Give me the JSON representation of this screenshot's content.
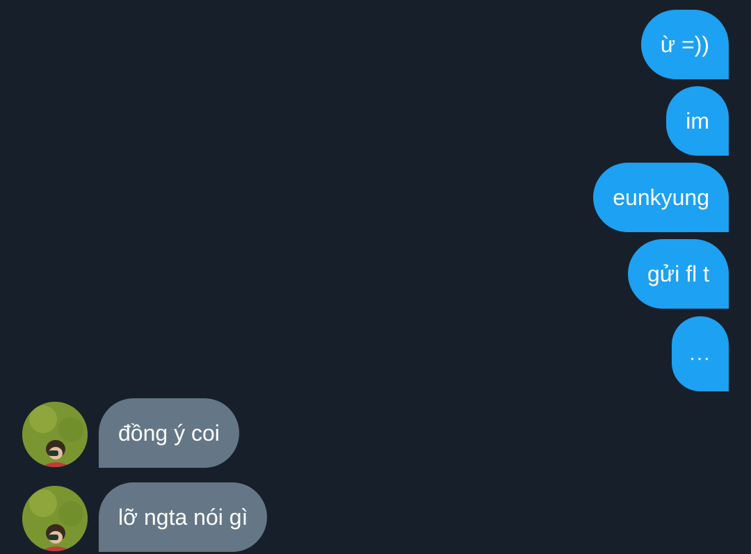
{
  "conversation": {
    "outgoing": [
      {
        "text": "ừ =))"
      },
      {
        "text": "im"
      },
      {
        "text": "eunkyung"
      },
      {
        "text": "gửi fl t"
      },
      {
        "text": "..."
      }
    ],
    "incoming": [
      {
        "text": "đồng ý coi"
      },
      {
        "text": "lỡ ngta nói gì"
      }
    ]
  },
  "colors": {
    "background": "#17202a",
    "outgoing_bubble": "#1da1f2",
    "incoming_bubble": "#657786",
    "text": "#ffffff"
  },
  "icons": {
    "avatar": "avatar-photo-icon"
  }
}
